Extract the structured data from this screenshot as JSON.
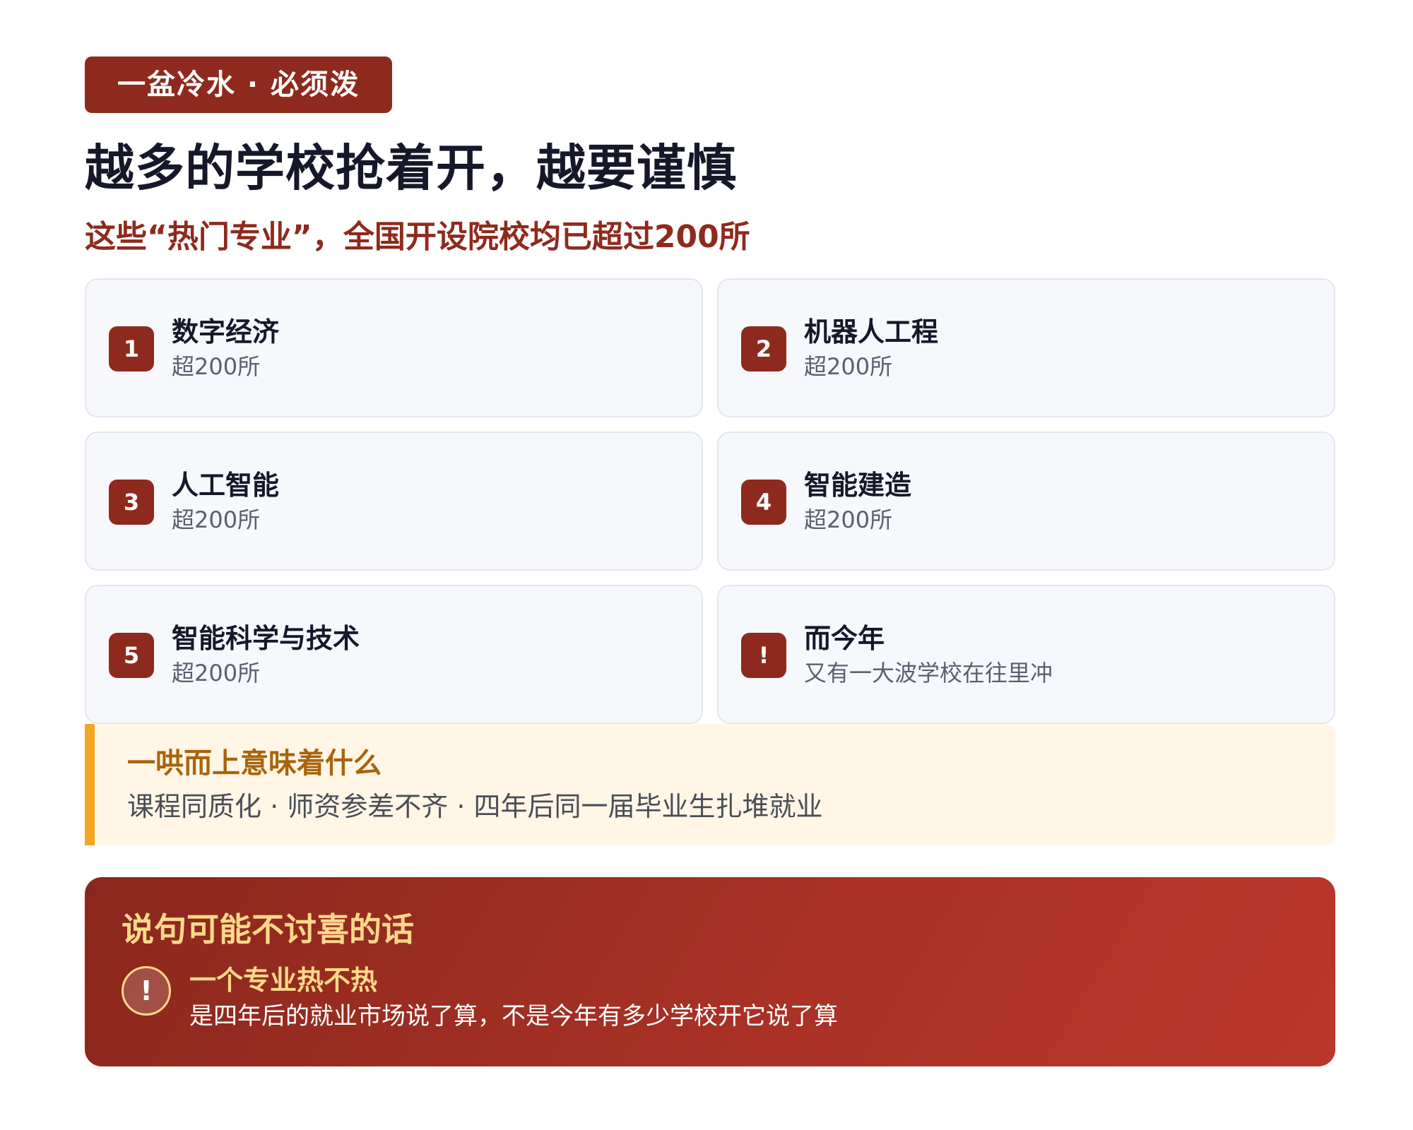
{
  "tag": "一盆冷水 · 必须泼",
  "title": "越多的学校抢着开，越要谨慎",
  "subtitle": "这些“热门专业”，全国开设院校均已超过200所",
  "cards": [
    {
      "badge": "1",
      "name": "数字经济",
      "desc": "超200所"
    },
    {
      "badge": "2",
      "name": "机器人工程",
      "desc": "超200所"
    },
    {
      "badge": "3",
      "name": "人工智能",
      "desc": "超200所"
    },
    {
      "badge": "4",
      "name": "智能建造",
      "desc": "超200所"
    },
    {
      "badge": "5",
      "name": "智能科学与技术",
      "desc": "超200所"
    },
    {
      "badge": "!",
      "name": "而今年",
      "desc": "又有一大波学校在往里冲"
    }
  ],
  "note": {
    "title": "一哄而上意味着什么",
    "text": "课程同质化 · 师资参差不齐 · 四年后同一届毕业生扎堆就业"
  },
  "banner": {
    "title": "说句可能不讨喜的话",
    "icon": "!",
    "sub": "一个专业热不热",
    "text": "是四年后的就业市场说了算，不是今年有多少学校开它说了算"
  },
  "colors": {
    "accent": "#8e2a1d",
    "highlight": "#f4a623",
    "banner_text": "#ffd98a"
  }
}
